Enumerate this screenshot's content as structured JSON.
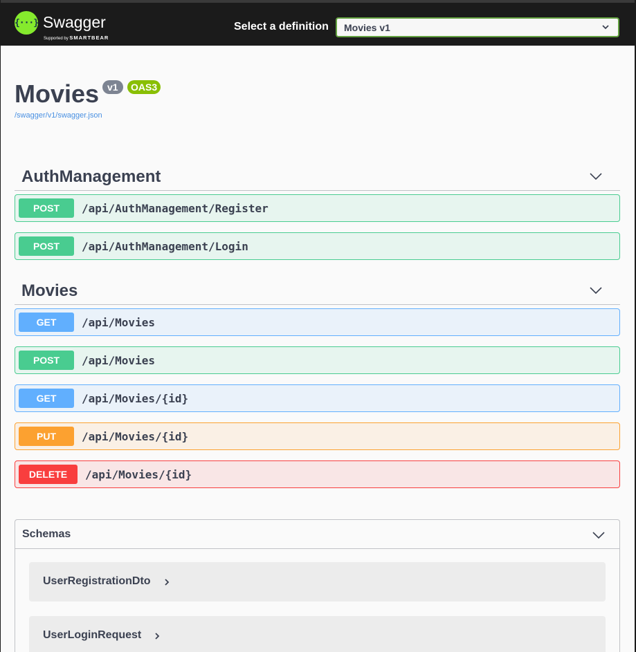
{
  "header": {
    "logo_name": "Swagger",
    "logo_supported": "Supported by",
    "logo_company": "SMARTBEAR",
    "definition_label": "Select a definition",
    "definition_value": "Movies v1"
  },
  "info": {
    "title": "Movies",
    "version": "v1",
    "oas": "OAS3",
    "spec_url": "/swagger/v1/swagger.json"
  },
  "tags": [
    {
      "name": "AuthManagement",
      "operations": [
        {
          "method": "POST",
          "path": "/api/AuthManagement/Register"
        },
        {
          "method": "POST",
          "path": "/api/AuthManagement/Login"
        }
      ]
    },
    {
      "name": "Movies",
      "operations": [
        {
          "method": "GET",
          "path": "/api/Movies"
        },
        {
          "method": "POST",
          "path": "/api/Movies"
        },
        {
          "method": "GET",
          "path": "/api/Movies/{id}"
        },
        {
          "method": "PUT",
          "path": "/api/Movies/{id}"
        },
        {
          "method": "DELETE",
          "path": "/api/Movies/{id}"
        }
      ]
    }
  ],
  "schemas": {
    "title": "Schemas",
    "models": [
      {
        "name": "UserRegistrationDto"
      },
      {
        "name": "UserLoginRequest"
      }
    ]
  },
  "colors": {
    "post": "#49cc90",
    "get": "#61affe",
    "put": "#fca130",
    "delete": "#f93e3e",
    "oas_badge": "#89bf04",
    "logo": "#85ea2d"
  }
}
